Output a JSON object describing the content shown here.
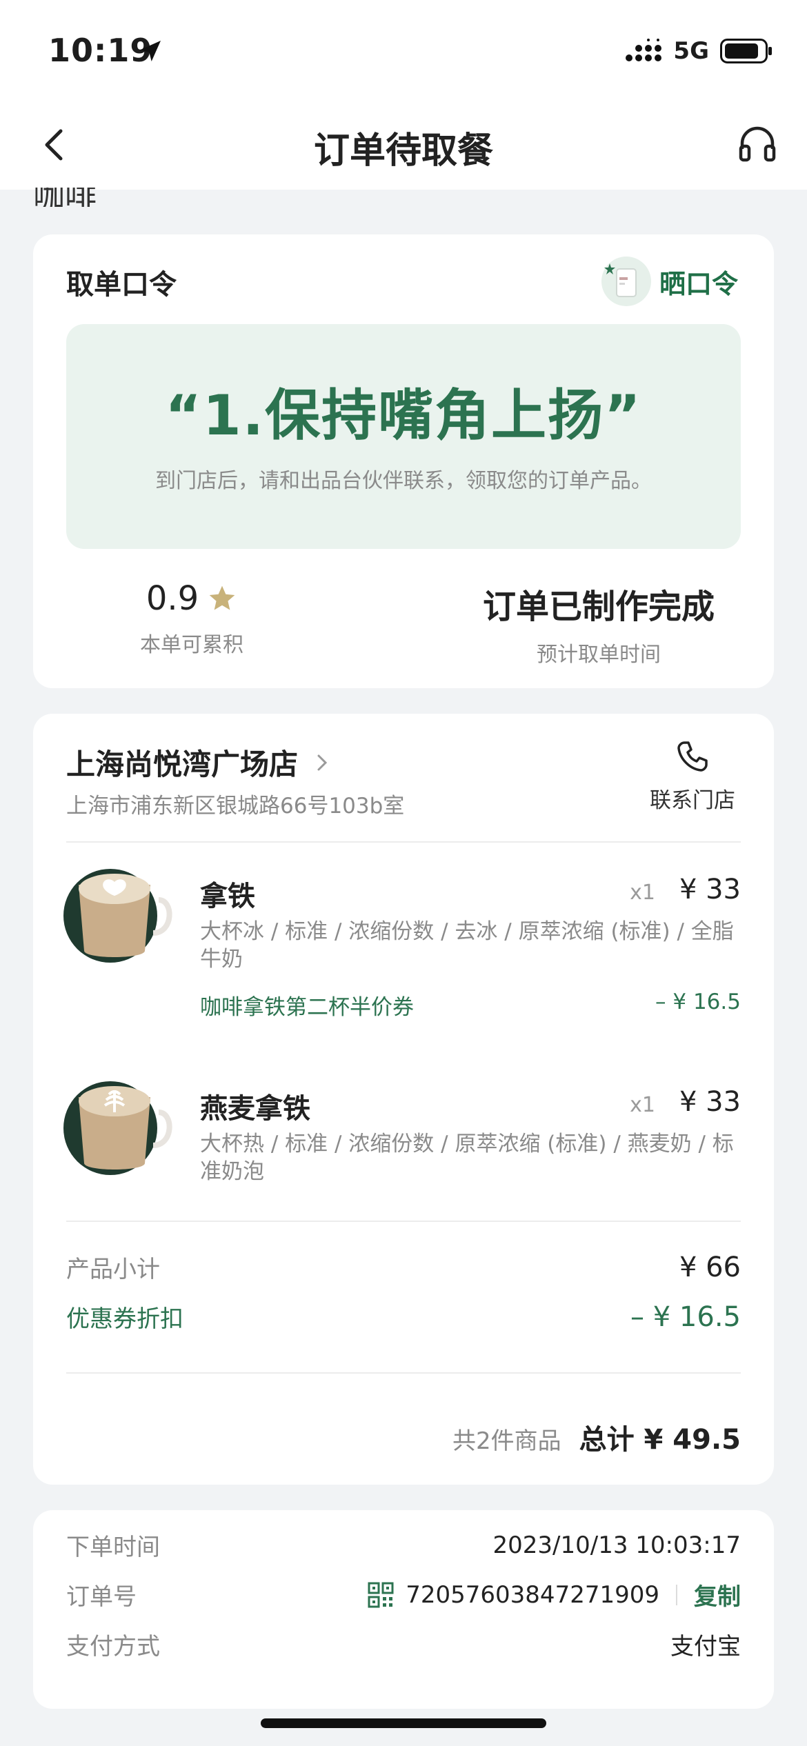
{
  "status_bar": {
    "time": "10:19",
    "network": "5G"
  },
  "nav": {
    "title": "订单待取餐"
  },
  "scroll_peek": "咖啡",
  "pickup": {
    "title": "取单口令",
    "share_label": "晒口令",
    "code": "“1.保持嘴角上扬”",
    "hint": "到门店后，请和出品台伙伴联系，领取您的订单产品。",
    "stars_value": "0.9",
    "stars_label": "本单可累积",
    "status_value": "订单已制作完成",
    "status_label": "预计取单时间"
  },
  "store": {
    "name": "上海尚悦湾广场店",
    "address": "上海市浦东新区银城路66号103b室",
    "contact_label": "联系门店"
  },
  "items": [
    {
      "name": "拿铁",
      "qty": "x1",
      "price": "¥ 33",
      "spec": "大杯冰 / 标准 / 浓缩份数 / 去冰 / 原萃浓缩 (标准) / 全脂牛奶",
      "coupon": "咖啡拿铁第二杯半价券",
      "discount": "– ¥ 16.5"
    },
    {
      "name": "燕麦拿铁",
      "qty": "x1",
      "price": "¥ 33",
      "spec": "大杯热 / 标准 / 浓缩份数 / 原萃浓缩 (标准) / 燕麦奶 / 标准奶泡"
    }
  ],
  "summary": {
    "subtotal_label": "产品小计",
    "subtotal_value": "¥ 66",
    "coupon_label": "优惠券折扣",
    "coupon_value": "– ¥ 16.5",
    "count_text": "共2件商品",
    "total_text": "总计 ¥ 49.5"
  },
  "order_info": {
    "time_label": "下单时间",
    "time_value": "2023/10/13 10:03:17",
    "number_label": "订单号",
    "number_value": "72057603847271909",
    "copy_label": "复制",
    "payment_label": "支付方式",
    "payment_value": "支付宝"
  },
  "colors": {
    "brand_green": "#2c7350",
    "background": "#f1f3f5",
    "star_gold": "#c8b27a"
  }
}
